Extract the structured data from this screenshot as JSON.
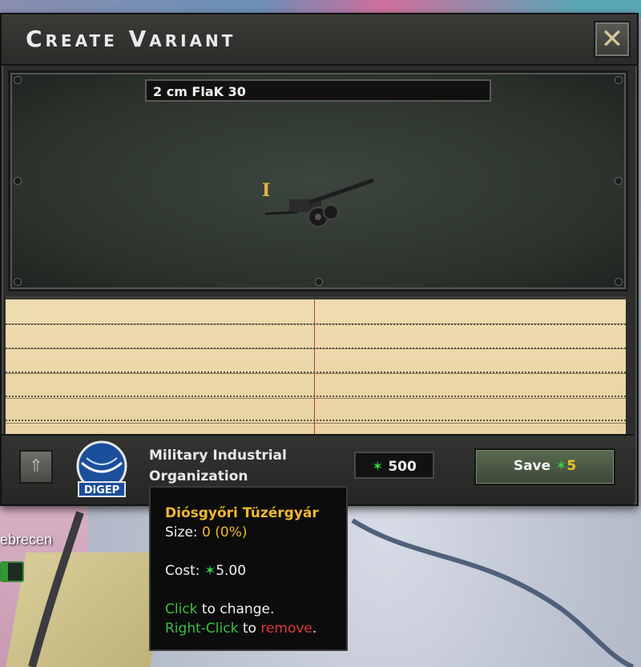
{
  "window": {
    "title": "Create Variant",
    "close_label": "✕"
  },
  "preview": {
    "variant_name": "2 cm FlaK 30",
    "cursor_glyph": "I"
  },
  "bottom_bar": {
    "up_arrow": "⇑",
    "org_label_line1": "Military Industrial",
    "org_label_line2": "Organization",
    "logo_text": "DiGEP",
    "cost_star": "✶",
    "cost_value": "500",
    "save_label": "Save",
    "save_star": "✶",
    "save_cost": "5"
  },
  "tooltip": {
    "title": "Diósgyőri Tüzérgyár",
    "size_label": "Size:",
    "size_value": "0",
    "size_pct": "(0%)",
    "cost_label": "Cost:",
    "cost_star": "✶",
    "cost_value": "5.00",
    "click_word": "Click",
    "click_rest": "to change.",
    "right_click_word": "Right-Click",
    "right_click_mid": "to",
    "remove_word": "remove",
    "remove_dot": "."
  },
  "map": {
    "city_name": "ebrecen"
  }
}
